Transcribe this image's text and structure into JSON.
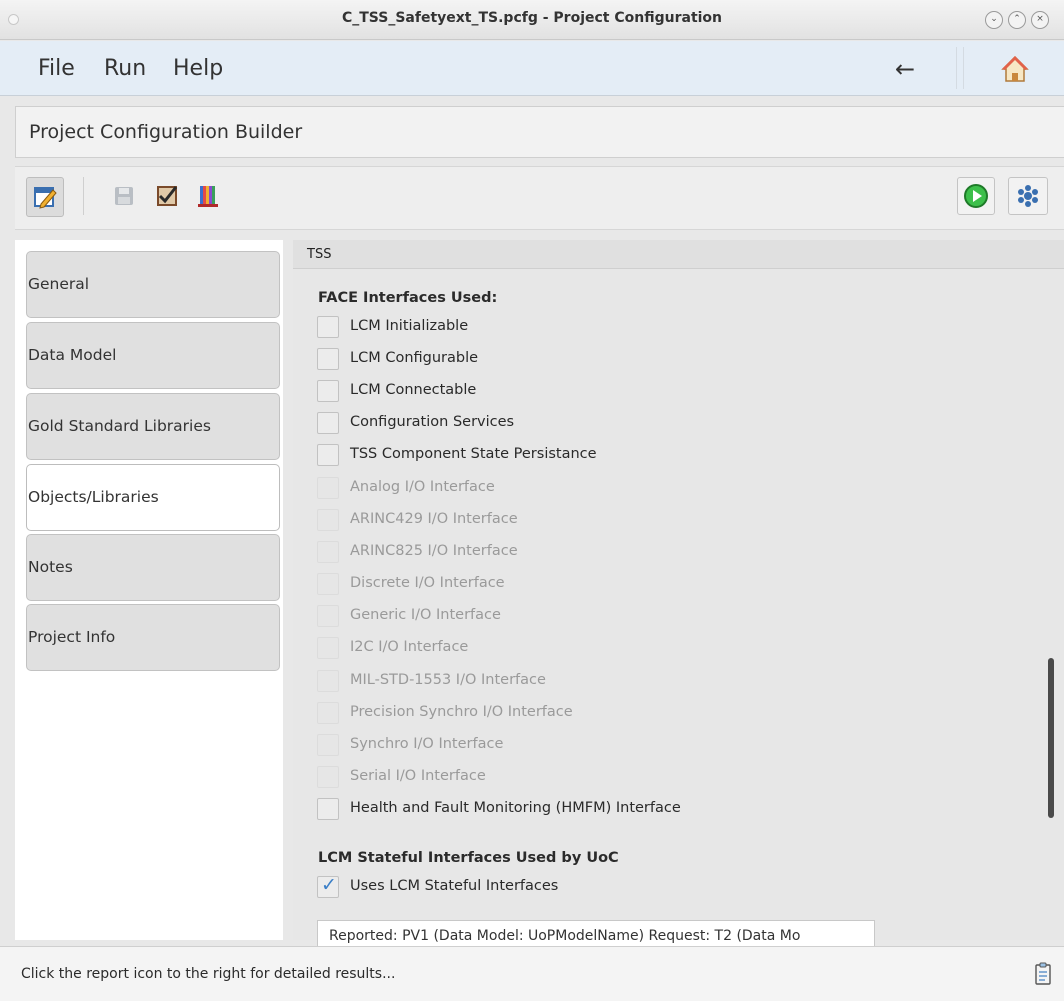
{
  "window": {
    "title": "C_TSS_Safetyext_TS.pcfg - Project Configuration",
    "controls": [
      "minimize-icon",
      "maximize-icon",
      "close-icon"
    ]
  },
  "menubar": {
    "items": [
      "File",
      "Run",
      "Help"
    ],
    "back_icon": "left-arrow-icon",
    "home_icon": "home-icon"
  },
  "builder": {
    "title": "Project Configuration Builder"
  },
  "toolbar": {
    "left_tools": [
      "edit-icon",
      "save-icon",
      "validate-icon",
      "library-icon"
    ],
    "right_tools": [
      "run-icon",
      "settings-icon"
    ]
  },
  "nav": {
    "tabs": [
      {
        "label": "General",
        "active": false
      },
      {
        "label": "Data Model",
        "active": false
      },
      {
        "label": "Gold Standard Libraries",
        "active": false
      },
      {
        "label": "Objects/Libraries",
        "active": true
      },
      {
        "label": "Notes",
        "active": false
      },
      {
        "label": "Project Info",
        "active": false
      }
    ]
  },
  "content": {
    "header": "TSS",
    "face_section_title": "FACE Interfaces Used:",
    "face_interfaces": [
      {
        "label": "LCM Initializable",
        "enabled": true,
        "checked": false
      },
      {
        "label": "LCM Configurable",
        "enabled": true,
        "checked": false
      },
      {
        "label": "LCM Connectable",
        "enabled": true,
        "checked": false
      },
      {
        "label": "Configuration Services",
        "enabled": true,
        "checked": false
      },
      {
        "label": "TSS Component State Persistance",
        "enabled": true,
        "checked": false
      },
      {
        "label": "Analog I/O Interface",
        "enabled": false,
        "checked": false
      },
      {
        "label": "ARINC429 I/O Interface",
        "enabled": false,
        "checked": false
      },
      {
        "label": "ARINC825 I/O Interface",
        "enabled": false,
        "checked": false
      },
      {
        "label": "Discrete I/O Interface",
        "enabled": false,
        "checked": false
      },
      {
        "label": "Generic I/O Interface",
        "enabled": false,
        "checked": false
      },
      {
        "label": "I2C I/O Interface",
        "enabled": false,
        "checked": false
      },
      {
        "label": "MIL-STD-1553 I/O Interface",
        "enabled": false,
        "checked": false
      },
      {
        "label": "Precision Synchro I/O Interface",
        "enabled": false,
        "checked": false
      },
      {
        "label": "Synchro I/O Interface",
        "enabled": false,
        "checked": false
      },
      {
        "label": "Serial I/O Interface",
        "enabled": false,
        "checked": false
      },
      {
        "label": "Health and Fault Monitoring (HMFM) Interface",
        "enabled": true,
        "checked": false
      }
    ],
    "lcm_section_title": "LCM Stateful Interfaces Used by UoC",
    "lcm_checkbox": {
      "label": "Uses LCM Stateful Interfaces",
      "checked": true
    },
    "report_field_value": "Reported: PV1 (Data Model: UoPModelName) Request: T2 (Data Mo"
  },
  "statusbar": {
    "text": "Click the report icon to the right for detailed results...",
    "icon": "report-icon"
  }
}
